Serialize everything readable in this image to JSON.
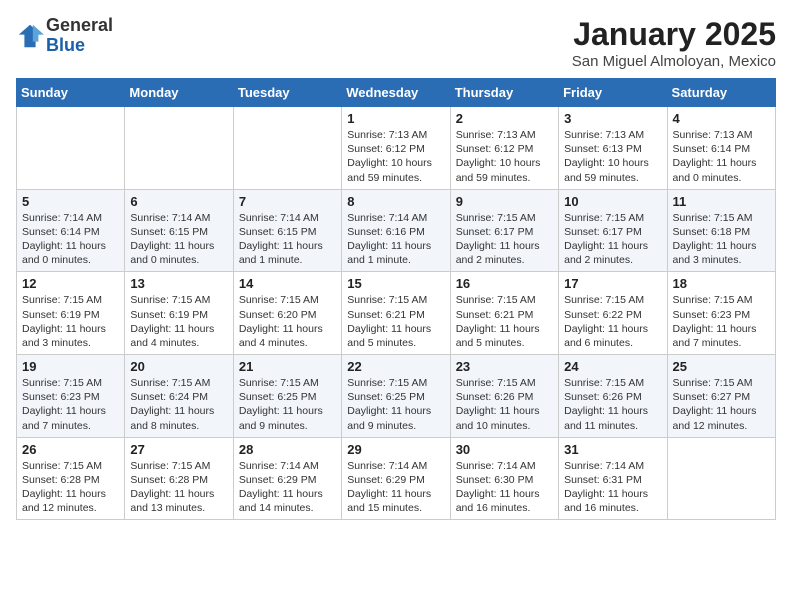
{
  "header": {
    "logo_general": "General",
    "logo_blue": "Blue",
    "month": "January 2025",
    "location": "San Miguel Almoloyan, Mexico"
  },
  "days_of_week": [
    "Sunday",
    "Monday",
    "Tuesday",
    "Wednesday",
    "Thursday",
    "Friday",
    "Saturday"
  ],
  "weeks": [
    [
      {
        "day": "",
        "info": ""
      },
      {
        "day": "",
        "info": ""
      },
      {
        "day": "",
        "info": ""
      },
      {
        "day": "1",
        "info": "Sunrise: 7:13 AM\nSunset: 6:12 PM\nDaylight: 10 hours and 59 minutes."
      },
      {
        "day": "2",
        "info": "Sunrise: 7:13 AM\nSunset: 6:12 PM\nDaylight: 10 hours and 59 minutes."
      },
      {
        "day": "3",
        "info": "Sunrise: 7:13 AM\nSunset: 6:13 PM\nDaylight: 10 hours and 59 minutes."
      },
      {
        "day": "4",
        "info": "Sunrise: 7:13 AM\nSunset: 6:14 PM\nDaylight: 11 hours and 0 minutes."
      }
    ],
    [
      {
        "day": "5",
        "info": "Sunrise: 7:14 AM\nSunset: 6:14 PM\nDaylight: 11 hours and 0 minutes."
      },
      {
        "day": "6",
        "info": "Sunrise: 7:14 AM\nSunset: 6:15 PM\nDaylight: 11 hours and 0 minutes."
      },
      {
        "day": "7",
        "info": "Sunrise: 7:14 AM\nSunset: 6:15 PM\nDaylight: 11 hours and 1 minute."
      },
      {
        "day": "8",
        "info": "Sunrise: 7:14 AM\nSunset: 6:16 PM\nDaylight: 11 hours and 1 minute."
      },
      {
        "day": "9",
        "info": "Sunrise: 7:15 AM\nSunset: 6:17 PM\nDaylight: 11 hours and 2 minutes."
      },
      {
        "day": "10",
        "info": "Sunrise: 7:15 AM\nSunset: 6:17 PM\nDaylight: 11 hours and 2 minutes."
      },
      {
        "day": "11",
        "info": "Sunrise: 7:15 AM\nSunset: 6:18 PM\nDaylight: 11 hours and 3 minutes."
      }
    ],
    [
      {
        "day": "12",
        "info": "Sunrise: 7:15 AM\nSunset: 6:19 PM\nDaylight: 11 hours and 3 minutes."
      },
      {
        "day": "13",
        "info": "Sunrise: 7:15 AM\nSunset: 6:19 PM\nDaylight: 11 hours and 4 minutes."
      },
      {
        "day": "14",
        "info": "Sunrise: 7:15 AM\nSunset: 6:20 PM\nDaylight: 11 hours and 4 minutes."
      },
      {
        "day": "15",
        "info": "Sunrise: 7:15 AM\nSunset: 6:21 PM\nDaylight: 11 hours and 5 minutes."
      },
      {
        "day": "16",
        "info": "Sunrise: 7:15 AM\nSunset: 6:21 PM\nDaylight: 11 hours and 5 minutes."
      },
      {
        "day": "17",
        "info": "Sunrise: 7:15 AM\nSunset: 6:22 PM\nDaylight: 11 hours and 6 minutes."
      },
      {
        "day": "18",
        "info": "Sunrise: 7:15 AM\nSunset: 6:23 PM\nDaylight: 11 hours and 7 minutes."
      }
    ],
    [
      {
        "day": "19",
        "info": "Sunrise: 7:15 AM\nSunset: 6:23 PM\nDaylight: 11 hours and 7 minutes."
      },
      {
        "day": "20",
        "info": "Sunrise: 7:15 AM\nSunset: 6:24 PM\nDaylight: 11 hours and 8 minutes."
      },
      {
        "day": "21",
        "info": "Sunrise: 7:15 AM\nSunset: 6:25 PM\nDaylight: 11 hours and 9 minutes."
      },
      {
        "day": "22",
        "info": "Sunrise: 7:15 AM\nSunset: 6:25 PM\nDaylight: 11 hours and 9 minutes."
      },
      {
        "day": "23",
        "info": "Sunrise: 7:15 AM\nSunset: 6:26 PM\nDaylight: 11 hours and 10 minutes."
      },
      {
        "day": "24",
        "info": "Sunrise: 7:15 AM\nSunset: 6:26 PM\nDaylight: 11 hours and 11 minutes."
      },
      {
        "day": "25",
        "info": "Sunrise: 7:15 AM\nSunset: 6:27 PM\nDaylight: 11 hours and 12 minutes."
      }
    ],
    [
      {
        "day": "26",
        "info": "Sunrise: 7:15 AM\nSunset: 6:28 PM\nDaylight: 11 hours and 12 minutes."
      },
      {
        "day": "27",
        "info": "Sunrise: 7:15 AM\nSunset: 6:28 PM\nDaylight: 11 hours and 13 minutes."
      },
      {
        "day": "28",
        "info": "Sunrise: 7:14 AM\nSunset: 6:29 PM\nDaylight: 11 hours and 14 minutes."
      },
      {
        "day": "29",
        "info": "Sunrise: 7:14 AM\nSunset: 6:29 PM\nDaylight: 11 hours and 15 minutes."
      },
      {
        "day": "30",
        "info": "Sunrise: 7:14 AM\nSunset: 6:30 PM\nDaylight: 11 hours and 16 minutes."
      },
      {
        "day": "31",
        "info": "Sunrise: 7:14 AM\nSunset: 6:31 PM\nDaylight: 11 hours and 16 minutes."
      },
      {
        "day": "",
        "info": ""
      }
    ]
  ]
}
